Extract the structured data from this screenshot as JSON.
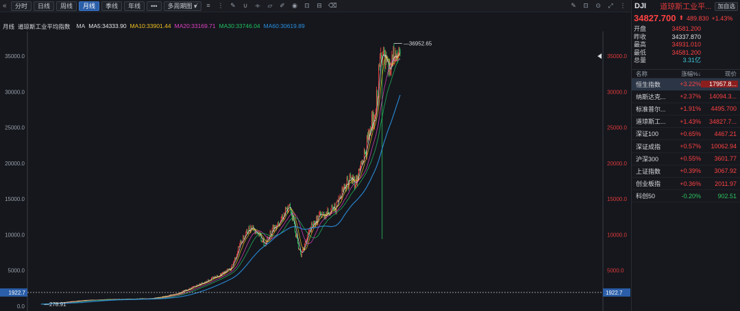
{
  "toolbar": {
    "nav_glyph": "«",
    "tabs": [
      "分时",
      "日线",
      "周线",
      "月线",
      "季线",
      "年线",
      "•••",
      "多周期图 ▾"
    ],
    "active_tab": "月线"
  },
  "ma_line": {
    "period_label": "月线",
    "index_name": "道琼斯工业平均指数",
    "ma_prefix": "MA",
    "ma5": "MA5:34333.90",
    "ma10": "MA10:33901.44",
    "ma20": "MA20:33169.71",
    "ma30": "MA30:33746.04",
    "ma60": "MA60:30619.89",
    "colors": {
      "ma5": "#e8e8e8",
      "ma10": "#f0c020",
      "ma20": "#e040c0",
      "ma30": "#20c060",
      "ma60": "#2a8fe0"
    }
  },
  "chart_data": {
    "type": "candlestick",
    "y_ticks": [
      "35000.0",
      "30000.0",
      "25000.0",
      "20000.0",
      "15000.0",
      "10000.0",
      "5000.0",
      "0.0"
    ],
    "ylim": [
      0,
      37500
    ],
    "max_label": "36952.65",
    "min_label": "278.91",
    "current_line": "1922.7",
    "series_colors": {
      "up": "#ff4242",
      "down": "#2fc45f"
    }
  },
  "sidebar": {
    "symbol": "DJI",
    "name": "道琼斯工业平...",
    "add_button": "加自选",
    "price": "34827.700",
    "arrow": "⬆",
    "change": "489.830",
    "change_pct": "+1.43%",
    "stats": [
      {
        "k": "开盘",
        "v": "34581.200",
        "color": "#ff4242"
      },
      {
        "k": "昨收",
        "v": "34337.870",
        "color": "#e0e2e6"
      },
      {
        "k": "最高",
        "v": "34931.010",
        "color": "#ff4242"
      },
      {
        "k": "最低",
        "v": "34581.200",
        "color": "#ff4242"
      },
      {
        "k": "总量",
        "v": "3.31亿",
        "color": "#40c8d8"
      }
    ],
    "table_headers": [
      "名称",
      "涨幅%↓",
      "现价"
    ],
    "rows": [
      {
        "name": "恒生指数",
        "pct": "+3.22%",
        "price": "17957.8...",
        "up": true,
        "sel": true,
        "hl": true
      },
      {
        "name": "纳斯达克...",
        "pct": "+2.37%",
        "price": "14094.3...",
        "up": true
      },
      {
        "name": "标准普尔...",
        "pct": "+1.91%",
        "price": "4495.700",
        "up": true
      },
      {
        "name": "道琼斯工...",
        "pct": "+1.43%",
        "price": "34827.7...",
        "up": true
      },
      {
        "name": "深证100",
        "pct": "+0.65%",
        "price": "4467.21",
        "up": true
      },
      {
        "name": "深证成指",
        "pct": "+0.57%",
        "price": "10062.94",
        "up": true
      },
      {
        "name": "沪深300",
        "pct": "+0.55%",
        "price": "3601.77",
        "up": true
      },
      {
        "name": "上证指数",
        "pct": "+0.39%",
        "price": "3067.92",
        "up": true
      },
      {
        "name": "创业板指",
        "pct": "+0.36%",
        "price": "2011.97",
        "up": true
      },
      {
        "name": "科创50",
        "pct": "-0.20%",
        "price": "902.51",
        "up": false
      }
    ]
  }
}
